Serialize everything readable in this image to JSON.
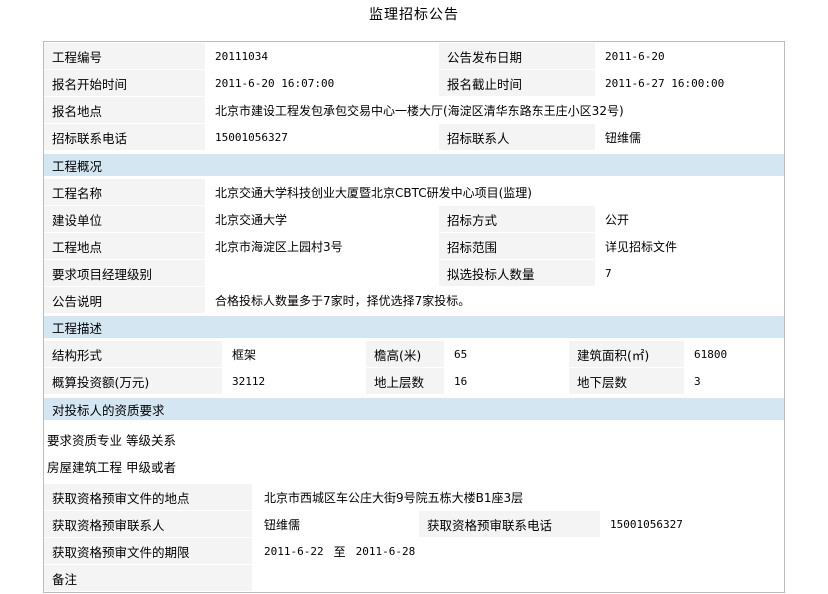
{
  "title": "监理招标公告",
  "top": {
    "project_no_label": "工程编号",
    "project_no": "20111034",
    "publish_date_label": "公告发布日期",
    "publish_date": "2011-6-20",
    "reg_start_label": "报名开始时间",
    "reg_start": "2011-6-20 16:07:00",
    "reg_end_label": "报名截止时间",
    "reg_end": "2011-6-27 16:00:00",
    "reg_place_label": "报名地点",
    "reg_place": "北京市建设工程发包承包交易中心一楼大厅(海淀区清华东路东王庄小区32号)",
    "phone_label": "招标联系电话",
    "phone": "15001056327",
    "contact_label": "招标联系人",
    "contact": "钮维儒"
  },
  "overview": {
    "header": "工程概况",
    "name_label": "工程名称",
    "name": "北京交通大学科技创业大厦暨北京CBTC研发中心项目(监理)",
    "builder_label": "建设单位",
    "builder": "北京交通大学",
    "method_label": "招标方式",
    "method": "公开",
    "location_label": "工程地点",
    "location": "北京市海淀区上园村3号",
    "scope_label": "招标范围",
    "scope": "详见招标文件",
    "pm_level_label": "要求项目经理级别",
    "pm_level": "",
    "bidders_label": "拟选投标人数量",
    "bidders": "7",
    "note_label": "公告说明",
    "note": "合格投标人数量多于7家时，择优选择7家投标。"
  },
  "description": {
    "header": "工程描述",
    "structure_label": "结构形式",
    "structure": "框架",
    "height_label": "檐高(米)",
    "height": "65",
    "area_label": "建筑面积(㎡)",
    "area": "61800",
    "budget_label": "概算投资额(万元)",
    "budget": "32112",
    "above_label": "地上层数",
    "above": "16",
    "below_label": "地下层数",
    "below": "3"
  },
  "qualification": {
    "header": "对投标人的资质要求",
    "line1": "要求资质专业 等级关系",
    "line2": "房屋建筑工程 甲级或者"
  },
  "prequal": {
    "place_label": "获取资格预审文件的地点",
    "place": "北京市西城区车公庄大街9号院五栋大楼B1座3层",
    "contact_label": "获取资格预审联系人",
    "contact": "钮维儒",
    "phone_label": "获取资格预审联系电话",
    "phone": "15001056327",
    "period_label": "获取资格预审文件的期限",
    "period_start": "2011-6-22",
    "period_to": "至",
    "period_end": "2011-6-28",
    "remark_label": "备注",
    "remark": ""
  }
}
